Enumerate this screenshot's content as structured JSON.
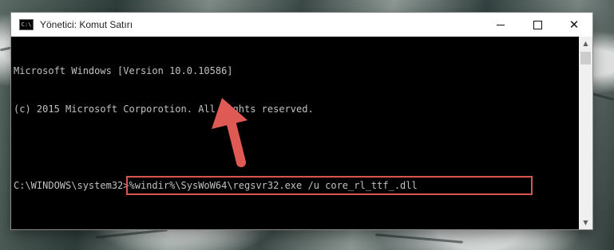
{
  "window": {
    "title": "Yönetici: Komut Satırı",
    "icon_label": "C:\\",
    "icon": "cmd-icon",
    "controls": {
      "minimize": "minimize-icon",
      "maximize": "maximize-icon",
      "close": "close-icon",
      "close_glyph": "✕"
    }
  },
  "console": {
    "lines": [
      "Microsoft Windows [Version 10.0.10586]",
      "(c) 2015 Microsoft Corporotion. All rights reserved.",
      ""
    ],
    "prompt": "C:\\WINDOWS\\system32>",
    "command": "%windir%\\SysWoW64\\regsvr32.exe /u core_rl_ttf_.dll"
  },
  "scrollbar": {
    "up_glyph": "▲",
    "down_glyph": "▼"
  },
  "colors": {
    "highlight_box": "#d9534f",
    "arrow": "#e05a55",
    "console_text": "#c0c0c0",
    "console_bg": "#000000"
  }
}
